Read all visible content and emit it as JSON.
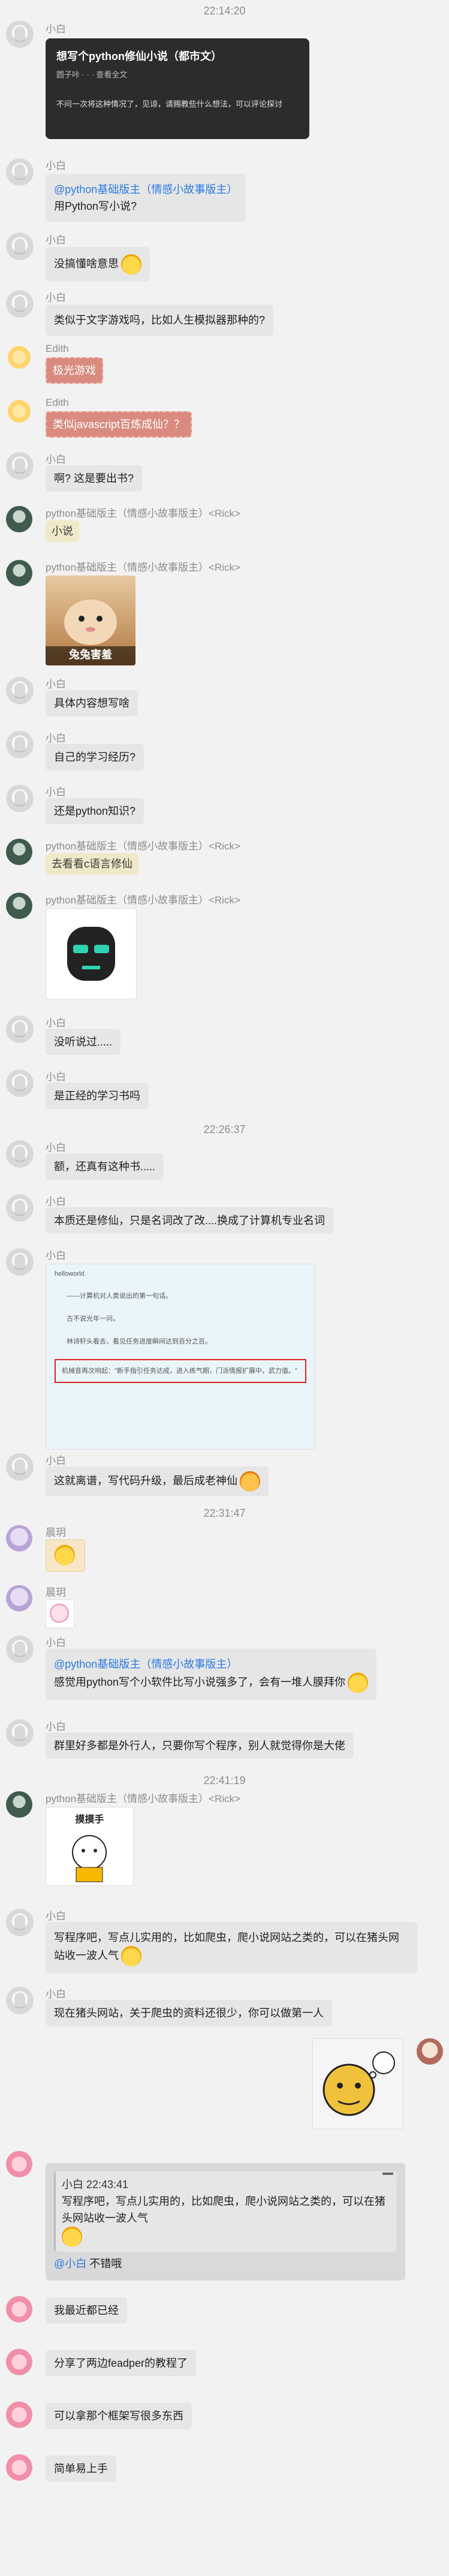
{
  "times": {
    "t1": "22:14:20",
    "t2": "22:26:37",
    "t3": "22:31:47",
    "t4": "22:41:19"
  },
  "names": {
    "xiaobai": "小白",
    "edith": "Edith",
    "rick": "python基础版主（情感小故事版主）<Rick>",
    "xiaoqiang": "晨玥"
  },
  "card": {
    "title": "想写个python修仙小说（都市文）",
    "meta": "圆子咔 · · · 查看全文",
    "body": "不问一次将这种情况了，见谅，请赐教些什么想法，可以评论探讨"
  },
  "messages": {
    "m1_mention": "@python基础版主（情感小故事版主）",
    "m1_text": "用Python写小说?",
    "m2": "没搞懂啥意思",
    "m3": "类似于文字游戏吗，比如人生模拟器那种的?",
    "m4": "极光游戏",
    "m5": "类似javascript百炼成仙？？",
    "m6": "啊? 这是要出书?",
    "m7": "小说",
    "m7_sticker": "兔兔害羞",
    "m8": "具体内容想写啥",
    "m9": "自己的学习经历?",
    "m10": "还是python知识?",
    "m11": "去看看c语言修仙",
    "m12": "没听说过.....",
    "m13": "是正经的学习书吗",
    "m14": "额，还真有这种书.....",
    "m15": "本质还是修仙，只是名词改了改....换成了计算机专业名词",
    "m16": "这就离谱，写代码升级，最后成老神仙",
    "m17_mention": "@python基础版主（情感小故事版主）",
    "m17_text": "感觉用python写个小软件比写小说强多了，会有一堆人膜拜你",
    "m18": "群里好多都是外行人，只要你写个程序，别人就觉得你是大佬",
    "m18_sticker": "摸摸手",
    "m19": "写程序吧，写点儿实用的，比如爬虫，爬小说网站之类的，可以在猪头网站收一波人气",
    "m20": "现在猪头网站，关于爬虫的资料还很少，你可以做第一人",
    "q_head": "小白  22:43:41",
    "q_text": "写程序吧，写点儿实用的，比如爬虫，爬小说网站之类的，可以在猪头网站收一波人气",
    "q_reply_mention": "@小白",
    "q_reply": " 不错哦",
    "m21": "我最近都已经",
    "m22": "分享了两边feadper的教程了",
    "m23": "可以拿那个框架写很多东西",
    "m24": "简单易上手"
  },
  "screenshot": {
    "line1": "helloworld.",
    "line2": "——计算机对人类说出的第一句话。",
    "line3": "古不说光年一问。",
    "line4": "林诗轩头看去，看见任务进度瞬间达到百分之百。",
    "line5": "机械音再次响起：\"新手指引任务达成，进入练气期，门派情报扩展中，武力值。\""
  }
}
